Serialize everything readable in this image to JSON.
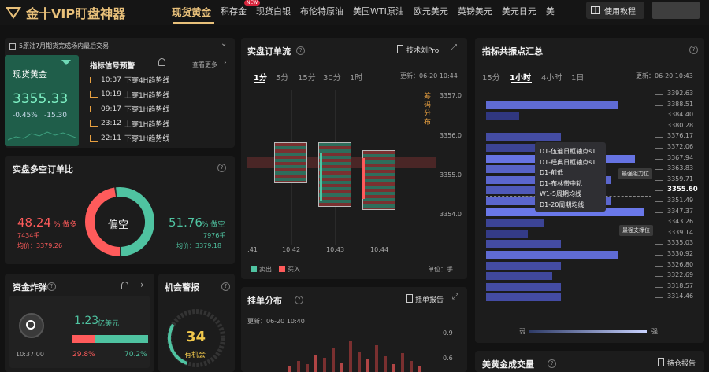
{
  "app": {
    "title": "金十VIP盯盘神器"
  },
  "nav": {
    "items": [
      "现货黄金",
      "积存金",
      "现货白银",
      "布伦特原油",
      "美国WTI原油",
      "欧元美元",
      "英镑美元",
      "美元日元",
      "美"
    ],
    "new_badge": "NEW",
    "tutorial": "使用教程"
  },
  "notice": {
    "text": "5原油7月期货完成场内最后交易"
  },
  "gold": {
    "name": "现货黄金",
    "price": "3355.33",
    "change_pct": "-0.45%",
    "change": "-15.30"
  },
  "signals": {
    "title": "指标信号预警",
    "more": "查看更多",
    "items": [
      {
        "time": "10:37",
        "text": "下穿4H趋势线"
      },
      {
        "time": "10:19",
        "text": "上穿1H趋势线"
      },
      {
        "time": "09:17",
        "text": "下穿1H趋势线"
      },
      {
        "time": "23:12",
        "text": "上穿1H趋势线"
      },
      {
        "time": "22:11",
        "text": "下穿1H趋势线"
      }
    ]
  },
  "longshort": {
    "title": "实盘多空订单比",
    "long_pct": "48.24",
    "long_unit": "% 做多",
    "long_lots": "7434手",
    "long_avg": "均价：3379.26",
    "center": "偏空",
    "short_pct": "51.76",
    "short_unit": "% 做空",
    "short_lots": "7976手",
    "short_avg": "均价：3379.18",
    "ratio": 0.4824
  },
  "orderflow": {
    "title": "实盘订单流",
    "tool": "技术刘Pro",
    "tabs": [
      "1分",
      "5分",
      "15分",
      "30分",
      "1时"
    ],
    "updated": "更新：06-20 10:44",
    "side": "筹码分布",
    "yticks": [
      "3357.0",
      "3356.0",
      "3355.0",
      "3354.0"
    ],
    "xticks": [
      ":41",
      "10:42",
      "10:43",
      "10:44"
    ],
    "legend_sell": "卖出",
    "legend_buy": "买入",
    "unit": "单位：手"
  },
  "resonance": {
    "title": "指标共振点汇总",
    "tabs": [
      "15分",
      "1小时",
      "4小时",
      "1日"
    ],
    "updated": "更新：06-20 10:43",
    "levels": [
      "3392.63",
      "3388.51",
      "3384.40",
      "3380.28",
      "3376.17",
      "3372.06",
      "3367.94",
      "3363.83",
      "3359.71",
      "3355.60",
      "3351.49",
      "3347.37",
      "3343.26",
      "3339.14",
      "3335.03",
      "3330.92",
      "3326.80",
      "3322.69",
      "3318.57",
      "3314.46"
    ],
    "strengths": [
      0,
      0.8,
      0.2,
      0,
      0.45,
      0.35,
      0.9,
      0.7,
      0.75,
      0.6,
      0.75,
      0.95,
      0.35,
      0.25,
      0.45,
      0.8,
      0.45,
      0.4,
      0.45,
      0.45
    ],
    "tooltip": [
      "D1-伍迪日枢轴点s1",
      "D1-经典日枢轴点s1",
      "D1-前低",
      "D1-布林带中轨",
      "W1-5周期均线",
      "D1-20周期均线"
    ],
    "resistance": "最强阻力位",
    "support": "最强支撑位",
    "weak": "弱",
    "strong": "强"
  },
  "bomb": {
    "title": "资金炸弹",
    "time": "10:37:00",
    "amount": "1.23",
    "unit": "亿美元",
    "left": "29.8%",
    "right": "70.2%"
  },
  "chance": {
    "title": "机会警报",
    "score": "34",
    "label": "有机会"
  },
  "depth": {
    "title": "挂单分布",
    "report": "挂单报告",
    "updated": "更新：06-20 10:40",
    "yticks": [
      "0.9",
      "0.6"
    ]
  },
  "volume": {
    "title": "美黄金成交量",
    "report": "持仓报告"
  }
}
